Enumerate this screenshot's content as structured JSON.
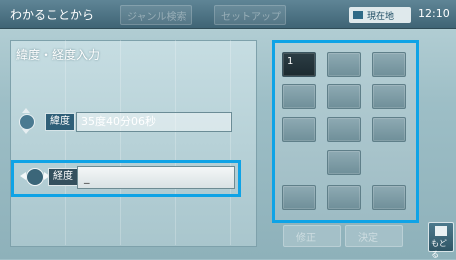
{
  "topbar": {
    "title": "わかることから",
    "ghost_tabs": [
      "ジャンル検索",
      "セットアップ"
    ],
    "badge": "現在地",
    "time": "12:10"
  },
  "panel": {
    "heading": "緯度・経度入力"
  },
  "latitude": {
    "label": "緯度",
    "value": "35度40分06秒"
  },
  "longitude": {
    "label": "経度",
    "value": "_"
  },
  "keypad": {
    "keys": [
      "1",
      "",
      "",
      "",
      "",
      "",
      "",
      "",
      "",
      "",
      "",
      "",
      "",
      "",
      ""
    ]
  },
  "buttons": {
    "left": "修正",
    "right": "決定"
  },
  "back": {
    "label": "もどる"
  },
  "colors": {
    "accent": "#0fa3e6",
    "topbar": "#4a6f80"
  }
}
